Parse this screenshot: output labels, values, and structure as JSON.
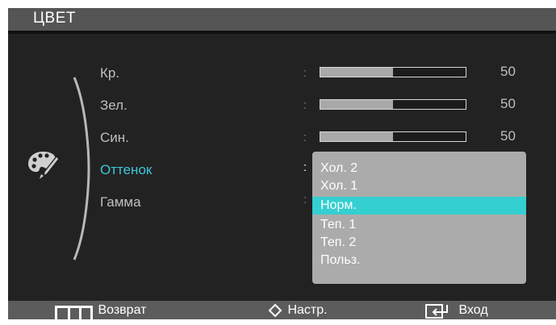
{
  "title": "ЦВЕТ",
  "icon": "palette-icon",
  "menu": {
    "items": [
      {
        "label": "Кр.",
        "value": "50",
        "level": 0.5
      },
      {
        "label": "Зел.",
        "value": "50",
        "level": 0.5
      },
      {
        "label": "Син.",
        "value": "50",
        "level": 0.5
      },
      {
        "label": "Оттенок"
      },
      {
        "label": "Гамма"
      }
    ],
    "separator": ":"
  },
  "dropdown": {
    "options": [
      "Хол. 2",
      "Хол. 1",
      "Норм.",
      "Теп. 1",
      "Теп. 2",
      "Польз."
    ],
    "selected": "Норм."
  },
  "footer": {
    "back": {
      "label": "Возврат",
      "icon": "menu-icon"
    },
    "adjust": {
      "label": "Настр.",
      "icon": "up-down-arrows-icon"
    },
    "enter": {
      "label": "Вход",
      "icon": "enter-icon"
    }
  },
  "colors": {
    "accent": "#3fc6d9",
    "highlight": "#34cfd0",
    "background": "#222222"
  }
}
